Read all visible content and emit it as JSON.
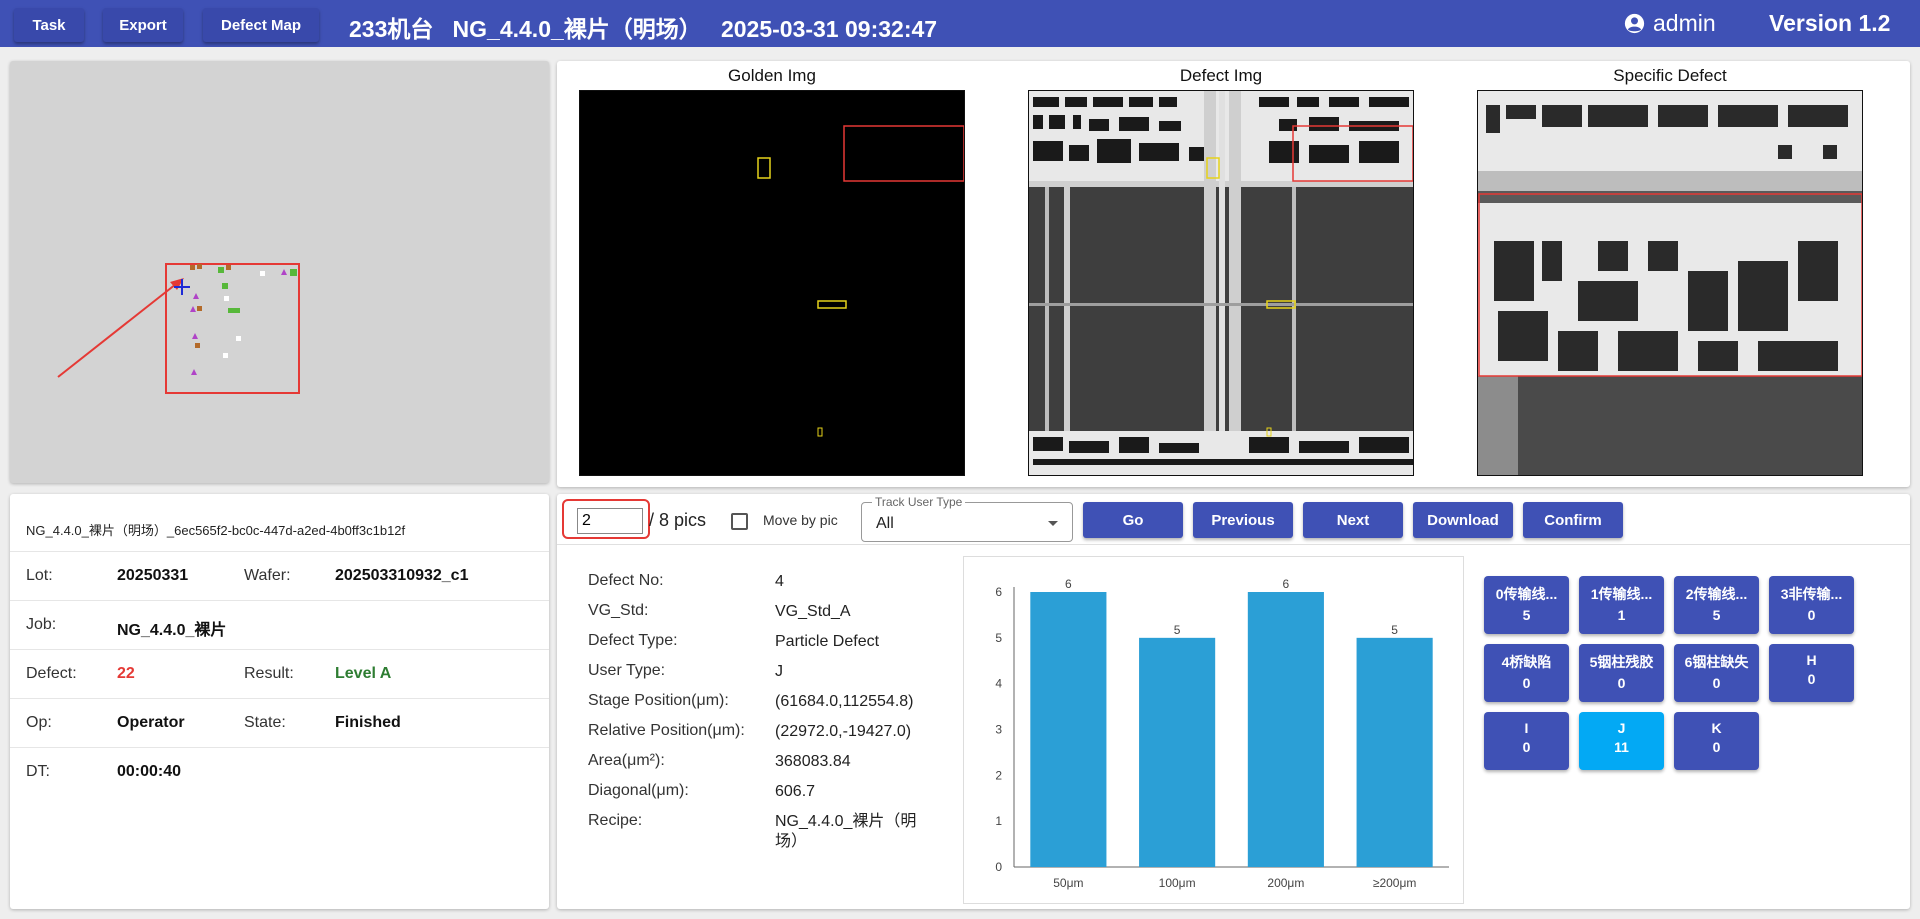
{
  "topbar": {
    "buttons": [
      "Task",
      "Export",
      "Defect Map"
    ],
    "title": "233机台   NG_4.4.0_裸片（明场）   2025-03-31 09:32:47",
    "user": "admin",
    "version": "Version 1.2",
    "bg_color": "#3f51b5"
  },
  "images": {
    "golden_title": "Golden Img",
    "defect_title": "Defect Img",
    "specific_title": "Specific Defect"
  },
  "info": {
    "file_name": "NG_4.4.0_裸片（明场）_6ec565f2-bc0c-447d-a2ed-4b0ff3c1b12f",
    "lot_label": "Lot:",
    "lot": "20250331",
    "wafer_label": "Wafer:",
    "wafer": "202503310932_c1",
    "job_label": "Job:",
    "job": "NG_4.4.0_裸片",
    "defect_label": "Defect:",
    "defect": "22",
    "result_label": "Result:",
    "result": "Level A",
    "op_label": "Op:",
    "op": "Operator",
    "state_label": "State:",
    "state": "Finished",
    "dt_label": "DT:",
    "dt": "00:00:40",
    "defect_color": "#e53935",
    "result_color": "#2e7d32"
  },
  "controls": {
    "page": "2",
    "pics_text": "/ 8 pics",
    "move_by_pic": "Move by pic",
    "track_label": "Track User Type",
    "track_value": "All",
    "buttons": [
      "Go",
      "Previous",
      "Next",
      "Download",
      "Confirm"
    ]
  },
  "defect": {
    "rows": [
      {
        "label": "Defect No:",
        "value": "4"
      },
      {
        "label": "VG_Std:",
        "value": "VG_Std_A"
      },
      {
        "label": "Defect Type:",
        "value": "Particle Defect"
      },
      {
        "label": "User Type:",
        "value": "J"
      },
      {
        "label": "Stage Position(μm):",
        "value": "(61684.0,112554.8)"
      },
      {
        "label": "Relative Position(μm):",
        "value": "(22972.0,-19427.0)"
      },
      {
        "label": "Area(μm²):",
        "value": "368083.84"
      },
      {
        "label": "Diagonal(μm):",
        "value": "606.7"
      },
      {
        "label": "Recipe:",
        "value": "NG_4.4.0_裸片（明场）"
      }
    ]
  },
  "chart_data": {
    "type": "bar",
    "categories": [
      "50μm",
      "100μm",
      "200μm",
      "≥200μm"
    ],
    "values": [
      6,
      5,
      6,
      5
    ],
    "ylim": [
      0,
      6
    ],
    "yticks": [
      "0",
      "1",
      "2",
      "3",
      "4",
      "5",
      "6"
    ],
    "bar_color": "#2b9fd6",
    "title": "",
    "xlabel": "",
    "ylabel": ""
  },
  "categories": [
    {
      "name": "0传输线...",
      "count": "5"
    },
    {
      "name": "1传输线...",
      "count": "1"
    },
    {
      "name": "2传输线...",
      "count": "5"
    },
    {
      "name": "3非传输...",
      "count": "0"
    },
    {
      "name": "4桥缺陷",
      "count": "0"
    },
    {
      "name": "5铟柱残胶",
      "count": "0"
    },
    {
      "name": "6铟柱缺失",
      "count": "0"
    },
    {
      "name": "H",
      "count": "0"
    },
    {
      "name": "I",
      "count": "0"
    },
    {
      "name": "J",
      "count": "11"
    },
    {
      "name": "K",
      "count": "0"
    }
  ],
  "active_category": "J"
}
